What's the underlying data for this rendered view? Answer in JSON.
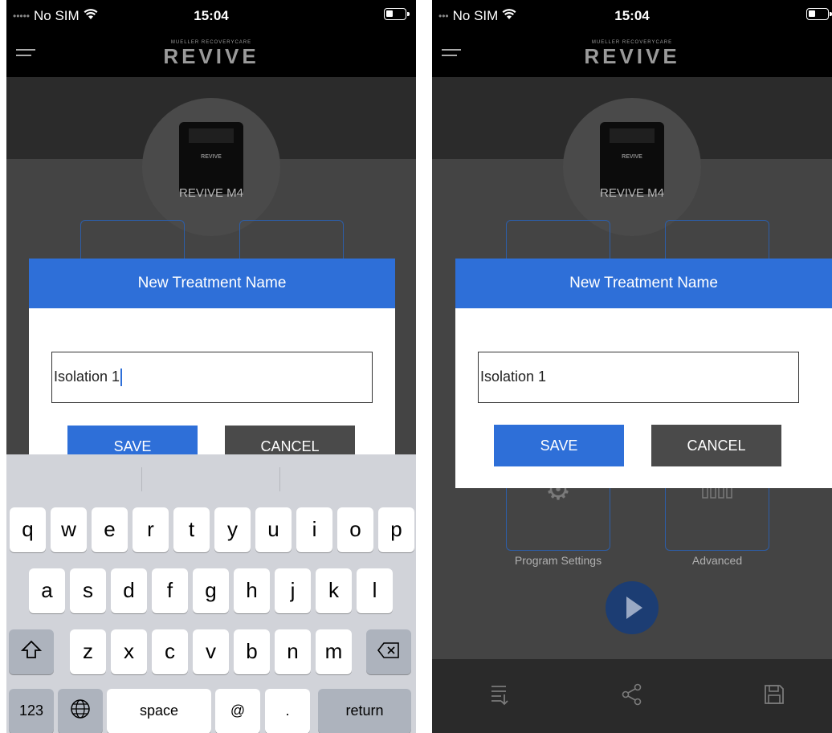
{
  "left": {
    "status": {
      "carrier": "No SIM",
      "time": "15:04"
    },
    "logo": {
      "tagline": "MUELLER RECOVERYCARE",
      "brand": "REVIVE"
    },
    "device_name": "REVIVE M4",
    "device_label": "REVIVE",
    "dialog": {
      "title": "New Treatment Name",
      "input_value": "Isolation 1",
      "save_label": "SAVE",
      "cancel_label": "CANCEL"
    },
    "keyboard": {
      "row1": [
        "q",
        "w",
        "e",
        "r",
        "t",
        "y",
        "u",
        "i",
        "o",
        "p"
      ],
      "row2": [
        "a",
        "s",
        "d",
        "f",
        "g",
        "h",
        "j",
        "k",
        "l"
      ],
      "row3": [
        "z",
        "x",
        "c",
        "v",
        "b",
        "n",
        "m"
      ],
      "shift_icon": "shift-icon",
      "backspace_icon": "backspace-icon",
      "numbers_label": "123",
      "globe_icon": "globe-icon",
      "space_label": "space",
      "at_label": "@",
      "dot_label": ".",
      "return_label": "return"
    }
  },
  "right": {
    "status": {
      "carrier": "No SIM",
      "time": "15:04"
    },
    "logo": {
      "tagline": "MUELLER RECOVERYCARE",
      "brand": "REVIVE"
    },
    "device_name": "REVIVE M4",
    "device_label": "REVIVE",
    "dialog": {
      "title": "New Treatment Name",
      "input_value": "Isolation 1",
      "save_label": "SAVE",
      "cancel_label": "CANCEL"
    },
    "tiles": {
      "program_settings": "Program Settings",
      "advanced": "Advanced"
    },
    "bottom_icons": [
      "list-icon",
      "share-icon",
      "save-disk-icon"
    ]
  },
  "colors": {
    "accent": "#2e6fd8",
    "header_dark": "#000000",
    "cancel": "#4a4a4a",
    "tile_border": "#2d5ea8"
  }
}
